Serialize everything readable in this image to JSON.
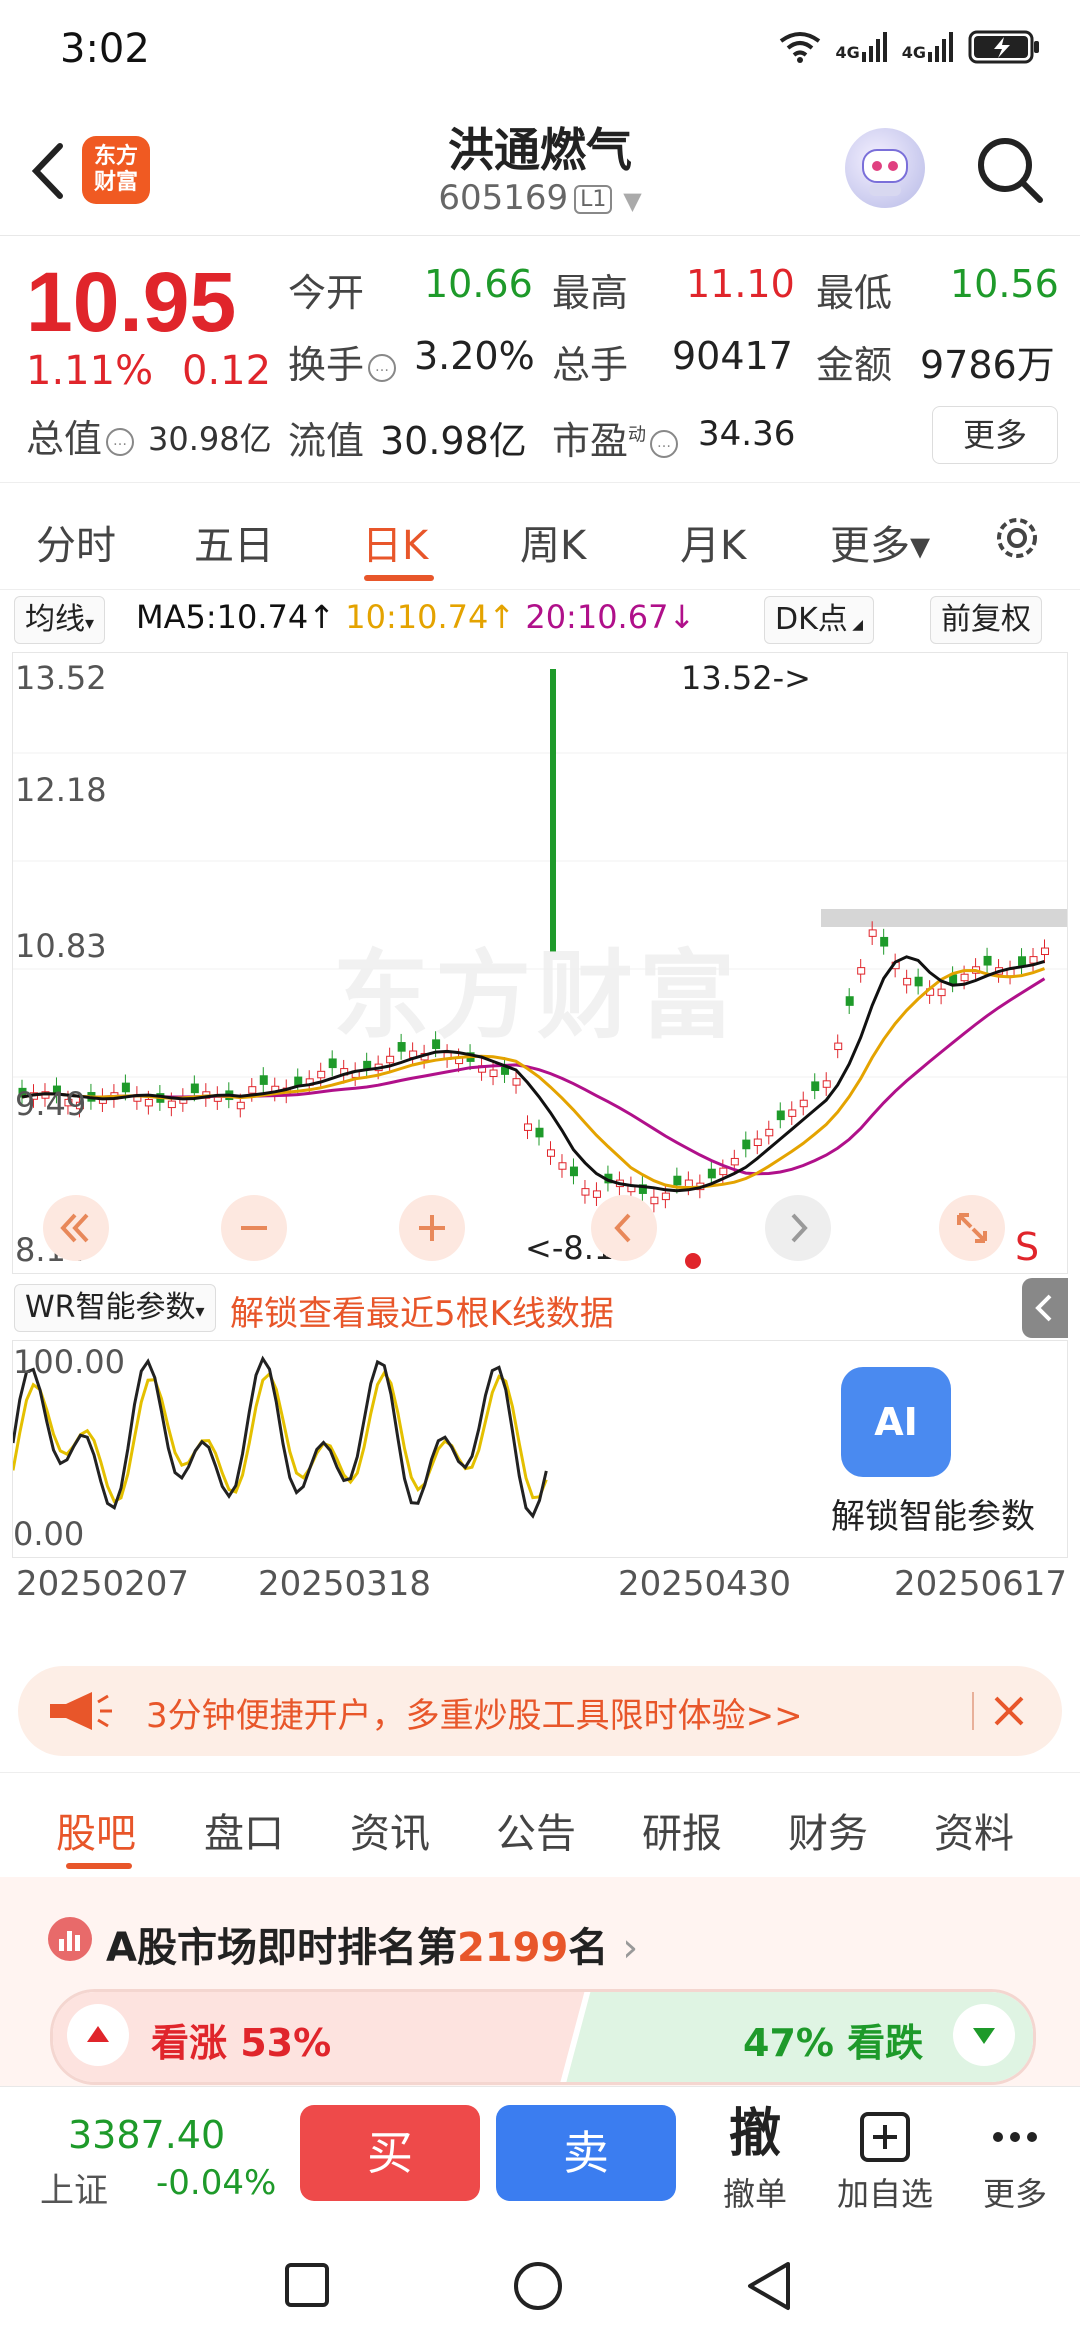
{
  "status_bar": {
    "time": "3:02",
    "signal_1": "4G",
    "signal_2": "4G"
  },
  "header": {
    "stock_name": "洪通燃气",
    "stock_code": "605169",
    "code_tag": "L1",
    "brand_logo_line1": "东方",
    "brand_logo_line2": "财富"
  },
  "quote": {
    "price": "10.95",
    "change_pct": "1.11%",
    "change_abs": "0.12",
    "total_cap_label": "总值",
    "total_cap_value": "30.98亿",
    "open_label": "今开",
    "open_value": "10.66",
    "high_label": "最高",
    "high_value": "11.10",
    "low_label": "最低",
    "low_value": "10.56",
    "turnover_label": "换手",
    "turnover_value": "3.20%",
    "volume_label": "总手",
    "volume_value": "90417",
    "amount_label": "金额",
    "amount_value": "9786万",
    "float_cap_label": "流值",
    "float_cap_value": "30.98亿",
    "pe_label": "市盈",
    "pe_sup": "动",
    "pe_value": "34.36",
    "more_label": "更多"
  },
  "period_tabs": [
    {
      "label": "分时",
      "active": false
    },
    {
      "label": "五日",
      "active": false
    },
    {
      "label": "日K",
      "active": true
    },
    {
      "label": "周K",
      "active": false
    },
    {
      "label": "月K",
      "active": false
    },
    {
      "label": "更多▾",
      "active": false
    }
  ],
  "ma_bar": {
    "selector": "均线",
    "ma5": "MA5:10.74↑",
    "ma10": "10:10.74↑",
    "ma20": "20:10.67↓",
    "dk_label": "DK点",
    "adjust_label": "前复权"
  },
  "kline": {
    "y_labels": [
      "13.52",
      "12.18",
      "10.83",
      "9.49",
      "8.14"
    ],
    "max_marker": "13.52->",
    "min_marker": "<-8.14",
    "watermark": "东方财富",
    "signal_letter": "S",
    "colors": {
      "up": "#e0252b",
      "down": "#1e9a2a",
      "ma5": "#111111",
      "ma10": "#e4a300",
      "ma20": "#b0108a"
    }
  },
  "wr": {
    "selector": "WR智能参数",
    "unlock_text": "解锁查看最近5根K线数据",
    "y_top": "100.00",
    "y_bottom": "0.00",
    "ai_badge": "AI",
    "ai_unlock": "解锁智能参数"
  },
  "dates": [
    "20250207",
    "20250318",
    "20250430",
    "20250617"
  ],
  "promo": {
    "text": "3分钟便捷开户，多重炒股工具限时体验>>"
  },
  "content_tabs": [
    {
      "label": "股吧",
      "active": true
    },
    {
      "label": "盘口",
      "active": false
    },
    {
      "label": "资讯",
      "active": false
    },
    {
      "label": "公告",
      "active": false
    },
    {
      "label": "研报",
      "active": false
    },
    {
      "label": "财务",
      "active": false
    },
    {
      "label": "资料",
      "active": false
    }
  ],
  "rank": {
    "prefix": "A股市场即时排名第",
    "number": "2199",
    "suffix": "名"
  },
  "sentiment": {
    "bull_label": "看涨 53%",
    "bear_label": "47% 看跌",
    "bull_pct": 53
  },
  "trade_bar": {
    "index_value": "3387.40",
    "index_name": "上证",
    "index_change": "-0.04%",
    "buy": "买",
    "sell": "卖",
    "cancel_icon": "撤",
    "cancel": "撤单",
    "watchlist": "加自选",
    "more": "更多"
  }
}
